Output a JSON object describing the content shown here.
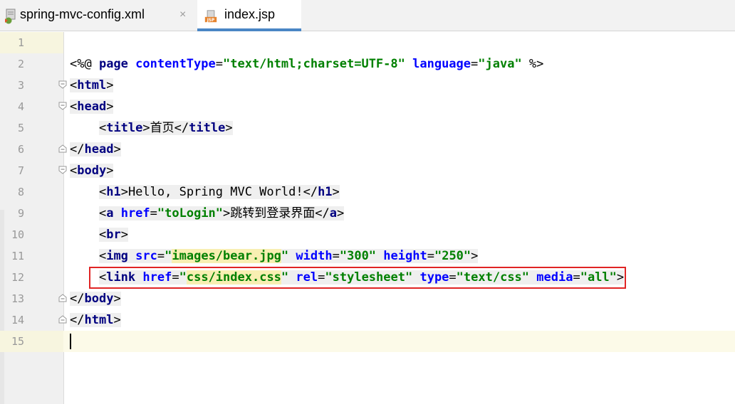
{
  "tabs": [
    {
      "label": "spring-mvc-config.xml",
      "icon": "xml-file-icon",
      "close": "×",
      "active": false
    },
    {
      "label": "index.jsp",
      "icon": "jsp-file-icon",
      "close": "",
      "active": true
    }
  ],
  "editor": {
    "line_numbers": [
      "1",
      "2",
      "3",
      "4",
      "5",
      "6",
      "7",
      "8",
      "9",
      "10",
      "11",
      "12",
      "13",
      "14",
      "15"
    ],
    "line2": {
      "open": "<%@ ",
      "page": "page",
      "sp1": " ",
      "ct_attr": "contentType",
      "eq1": "=",
      "ct_val": "\"text/html;charset=UTF-8\"",
      "sp2": " ",
      "lang_attr": "language",
      "eq2": "=",
      "lang_val": "\"java\"",
      "close": " %>"
    },
    "line3": {
      "lt": "<",
      "name": "html",
      "gt": ">"
    },
    "line4": {
      "lt": "<",
      "name": "head",
      "gt": ">"
    },
    "line5": {
      "indent": "    ",
      "lt": "<",
      "name": "title",
      "gt": ">",
      "text": "首页",
      "clt": "</",
      "cname": "title",
      "cgt": ">"
    },
    "line6": {
      "lt": "</",
      "name": "head",
      "gt": ">"
    },
    "line7": {
      "lt": "<",
      "name": "body",
      "gt": ">"
    },
    "line8": {
      "indent": "    ",
      "lt": "<",
      "name": "h1",
      "gt": ">",
      "text": "Hello, Spring MVC World!",
      "clt": "</",
      "cname": "h1",
      "cgt": ">"
    },
    "line9": {
      "indent": "    ",
      "lt": "<",
      "name": "a",
      "sp": " ",
      "attr": "href",
      "eq": "=",
      "val": "\"toLogin\"",
      "gt": ">",
      "text": "跳转到登录界面",
      "clt": "</",
      "cname": "a",
      "cgt": ">"
    },
    "line10": {
      "indent": "    ",
      "lt": "<",
      "name": "br",
      "gt": ">"
    },
    "line11": {
      "indent": "    ",
      "lt": "<",
      "name": "img",
      "sp1": " ",
      "a1": "src",
      "eq1": "=",
      "v1q1": "\"",
      "v1": "images/bear.jpg",
      "v1q2": "\"",
      "sp2": " ",
      "a2": "width",
      "eq2": "=",
      "v2": "\"300\"",
      "sp3": " ",
      "a3": "height",
      "eq3": "=",
      "v3": "\"250\"",
      "gt": ">"
    },
    "line12": {
      "indent": "    ",
      "lt": "<",
      "name": "link",
      "sp1": " ",
      "a1": "href",
      "eq1": "=",
      "v1q1": "\"",
      "v1": "css/index.css",
      "v1q2": "\"",
      "sp2": " ",
      "a2": "rel",
      "eq2": "=",
      "v2": "\"stylesheet\"",
      "sp3": " ",
      "a3": "type",
      "eq3": "=",
      "v3": "\"text/css\"",
      "sp4": " ",
      "a4": "media",
      "eq4": "=",
      "v4": "\"all\"",
      "gt": ">"
    },
    "line13": {
      "lt": "</",
      "name": "body",
      "gt": ">"
    },
    "line14": {
      "lt": "</",
      "name": "html",
      "gt": ">"
    }
  },
  "colors": {
    "tag_name": "#000080",
    "attr_name": "#0000ff",
    "attr_value": "#008000",
    "highlight_box": "#e02424",
    "active_tab_underline": "#4a86c5"
  }
}
